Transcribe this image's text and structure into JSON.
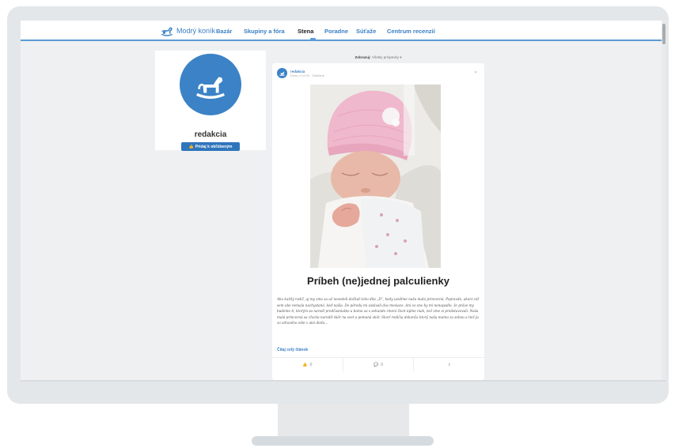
{
  "nav": {
    "logo_text": "Modrý koník",
    "items": [
      {
        "label": "Bazár",
        "active": false
      },
      {
        "label": "Skupiny a fóra",
        "active": false
      },
      {
        "label": "Stena",
        "active": true
      },
      {
        "label": "Poradne",
        "active": false
      },
      {
        "label": "Súťaže",
        "active": false
      },
      {
        "label": "Centrum recenzií",
        "active": false
      }
    ]
  },
  "profile": {
    "name": "redakcia",
    "follow_button": "Pridaj k obľúbeným",
    "avatar_icon": "rocking-horse-icon"
  },
  "feed": {
    "sort_label": "Zobrazuj:",
    "sort_value": "Všetky príspevky",
    "post": {
      "author": "redakcia",
      "time": "Dnes o 14:00 · Zdieľané",
      "title": "Príbeh (ne)jednej palculienky",
      "body": "Ako každý rodič, aj my sme sa už nevedeli dočkať toho dňa „D“, kedy uvidíme našu malú princeznú. Popravde, akoro niž sem obe nemala nachystané, keď našla. Do pôrodu mi ostávali dva mesiace. Ani vo sne by mi nenapadlo, že práve my budeme tí, ktorým sa narodí predčasniatko a bomu sa s sekunde zmení život úplne inak, než sme si predstavovali. Naša malá princezná sa chcela narodiť skôr na svet a pomaná skôr. Skorí rodičia dokonča ktorý našu mamu za sebou a tiež ju zo zdravého ešte v aké dieťa...",
      "read_more": "Čítaj celý článok",
      "likes": "0",
      "comments": "0",
      "colors": {
        "accent": "#3b82c6",
        "link": "#3b7fc4",
        "hat": "#f0b8cc"
      }
    }
  }
}
